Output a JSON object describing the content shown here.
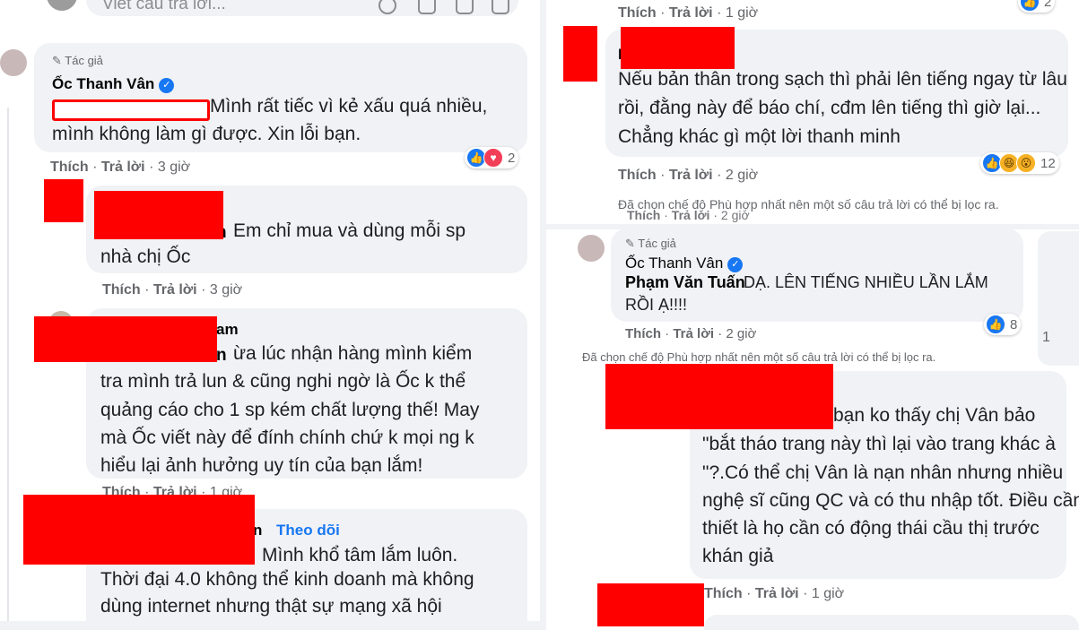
{
  "left": {
    "reply_input": {
      "placeholder": "Viết câu trả lời..."
    },
    "comments": [
      {
        "author_badge": "Tác giả",
        "author": "Ốc Thanh Vân",
        "lines": [
          "Mình rất tiếc vì kẻ xấu quá nhiều,",
          "mình không làm gì được. Xin lỗi bạn."
        ],
        "actions": {
          "like": "Thích",
          "reply": "Trả lời",
          "time": "3 giờ"
        },
        "reaction_count": "2"
      },
      {
        "name_suffix": "h",
        "lines": [
          "Em chỉ mua và dùng mỗi sp",
          "nhà chị Ốc"
        ],
        "actions": {
          "like": "Thích",
          "reply": "Trả lời",
          "time": "3 giờ"
        }
      },
      {
        "name_suffix": "am",
        "lines": [
          "ừa lúc nhận hàng mình kiểm",
          "tra mình trả lun & cũng nghi ngờ là Ốc k thể",
          "quảng cáo cho 1 sp kém chất lượng thế! May",
          "mà Ốc viết này để đính chính chứ k mọi ng k",
          "hiểu lại ảnh hưởng uy tín của bạn lắm!"
        ],
        "inline_name_suffix": "n",
        "actions": {
          "like": "Thích",
          "reply": "Trả lời",
          "time": "1 giờ"
        }
      },
      {
        "name_suffix": "n",
        "follow": "Theo dõi",
        "lines": [
          "Mình khổ tâm lắm luôn.",
          "Thời đại 4.0 không thể kinh doanh mà không",
          "dùng internet nhưng thật sự mạng xã hội"
        ]
      }
    ]
  },
  "right": {
    "top_actions": {
      "like": "Thích",
      "reply": "Trả lời",
      "time": "1 giờ",
      "reaction_count": "2"
    },
    "comments": [
      {
        "name_initial": "P",
        "lines": [
          "Nếu bản thân trong sạch thì phải lên tiếng ngay từ lâu",
          "rồi, đằng này để báo chí, cđm lên tiếng thì giờ lại...",
          "Chẳng khác gì một lời thanh minh"
        ],
        "actions": {
          "like": "Thích",
          "reply": "Trả lời",
          "time": "2 giờ"
        },
        "reaction_count": "12",
        "filter_notice": "Đã chọn chế độ Phù hợp nhất nên một số câu trả lời có thể bị lọc ra."
      },
      {
        "author_badge": "Tác giả",
        "author": "Ốc Thanh Vân",
        "tagged": "Phạm Văn Tuấn",
        "lines": [
          "DẠ. LÊN TIẾNG NHIỀU LẦN LẮM",
          "RỒI Ạ!!!!"
        ],
        "actions": {
          "like": "Thích",
          "reply": "Trả lời",
          "time": "2 giờ"
        },
        "reaction_count": "8",
        "side_count": "1",
        "filter_notice": "Đã chọn chế độ Phù hợp nhất nên một số câu trả lời có thể bị lọc ra."
      },
      {
        "lines": [
          "bạn ko thấy chị Vân bảo",
          "\"bắt tháo trang này thì lại vào trang khác à",
          "\"?.Có thể chị Vân là nạn nhân nhưng nhiều",
          "nghệ sĩ cũng QC và có thu nhập tốt. Điều cần",
          "thiết là họ cần có động thái cầu thị trước",
          "khán giả"
        ],
        "actions": {
          "like": "Thích",
          "reply": "Trả lời",
          "time": "1 giờ"
        }
      }
    ]
  },
  "colors": {
    "redaction": "#ff0000",
    "bubble": "#f0f2f5",
    "link": "#1877f2",
    "meta": "#65676b"
  }
}
